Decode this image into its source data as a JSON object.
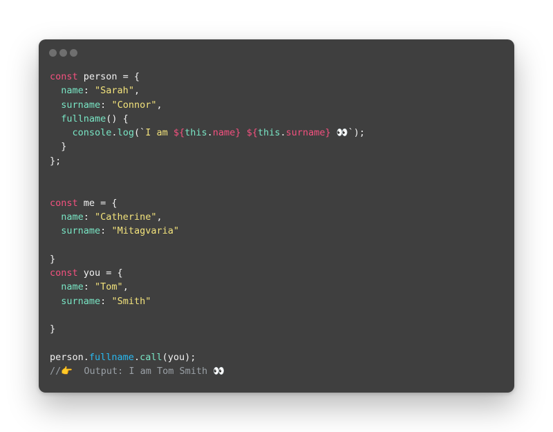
{
  "code": {
    "lines": [
      [
        {
          "t": "const",
          "c": "k"
        },
        {
          "t": " person = {",
          "c": ""
        }
      ],
      [
        {
          "t": "  ",
          "c": ""
        },
        {
          "t": "name",
          "c": "p"
        },
        {
          "t": ": ",
          "c": ""
        },
        {
          "t": "\"Sarah\"",
          "c": "s"
        },
        {
          "t": ",",
          "c": ""
        }
      ],
      [
        {
          "t": "  ",
          "c": ""
        },
        {
          "t": "surname",
          "c": "p"
        },
        {
          "t": ": ",
          "c": ""
        },
        {
          "t": "\"Connor\"",
          "c": "s"
        },
        {
          "t": ",",
          "c": ""
        }
      ],
      [
        {
          "t": "  ",
          "c": ""
        },
        {
          "t": "fullname",
          "c": "f"
        },
        {
          "t": "() {",
          "c": ""
        }
      ],
      [
        {
          "t": "    ",
          "c": ""
        },
        {
          "t": "console",
          "c": "f"
        },
        {
          "t": ".",
          "c": ""
        },
        {
          "t": "log",
          "c": "f"
        },
        {
          "t": "(`",
          "c": ""
        },
        {
          "t": "I am ",
          "c": "s"
        },
        {
          "t": "${",
          "c": "t"
        },
        {
          "t": "this",
          "c": "f"
        },
        {
          "t": ".",
          "c": ""
        },
        {
          "t": "name",
          "c": "t"
        },
        {
          "t": "}",
          "c": "t"
        },
        {
          "t": " ",
          "c": "s"
        },
        {
          "t": "${",
          "c": "t"
        },
        {
          "t": "this",
          "c": "f"
        },
        {
          "t": ".",
          "c": ""
        },
        {
          "t": "surname",
          "c": "t"
        },
        {
          "t": "}",
          "c": "t"
        },
        {
          "t": " 👀",
          "c": "s"
        },
        {
          "t": "`);",
          "c": ""
        }
      ],
      [
        {
          "t": "  }",
          "c": ""
        }
      ],
      [
        {
          "t": "};",
          "c": ""
        }
      ],
      [],
      [],
      [
        {
          "t": "const",
          "c": "k"
        },
        {
          "t": " me = {",
          "c": ""
        }
      ],
      [
        {
          "t": "  ",
          "c": ""
        },
        {
          "t": "name",
          "c": "p"
        },
        {
          "t": ": ",
          "c": ""
        },
        {
          "t": "\"Catherine\"",
          "c": "s"
        },
        {
          "t": ",",
          "c": ""
        }
      ],
      [
        {
          "t": "  ",
          "c": ""
        },
        {
          "t": "surname",
          "c": "p"
        },
        {
          "t": ": ",
          "c": ""
        },
        {
          "t": "\"Mitagvaria\"",
          "c": "s"
        }
      ],
      [],
      [
        {
          "t": "}",
          "c": ""
        }
      ],
      [
        {
          "t": "const",
          "c": "k"
        },
        {
          "t": " you = {",
          "c": ""
        }
      ],
      [
        {
          "t": "  ",
          "c": ""
        },
        {
          "t": "name",
          "c": "p"
        },
        {
          "t": ": ",
          "c": ""
        },
        {
          "t": "\"Tom\"",
          "c": "s"
        },
        {
          "t": ",",
          "c": ""
        }
      ],
      [
        {
          "t": "  ",
          "c": ""
        },
        {
          "t": "surname",
          "c": "p"
        },
        {
          "t": ": ",
          "c": ""
        },
        {
          "t": "\"Smith\"",
          "c": "s"
        }
      ],
      [],
      [
        {
          "t": "}",
          "c": ""
        }
      ],
      [],
      [
        {
          "t": "person.",
          "c": ""
        },
        {
          "t": "fullname",
          "c": "m"
        },
        {
          "t": ".",
          "c": ""
        },
        {
          "t": "call",
          "c": "f"
        },
        {
          "t": "(you);",
          "c": ""
        }
      ],
      [
        {
          "t": "//👉  Output: I am Tom Smith 👀",
          "c": "c"
        }
      ]
    ]
  },
  "colors": {
    "window_bg": "#3f3f3f",
    "keyword": "#f4517f",
    "property": "#79e6c5",
    "string": "#f3e37c",
    "comment": "#9aa0a6",
    "method": "#28b8f0"
  },
  "icons": [
    "traffic-light-dot",
    "traffic-light-dot",
    "traffic-light-dot"
  ]
}
